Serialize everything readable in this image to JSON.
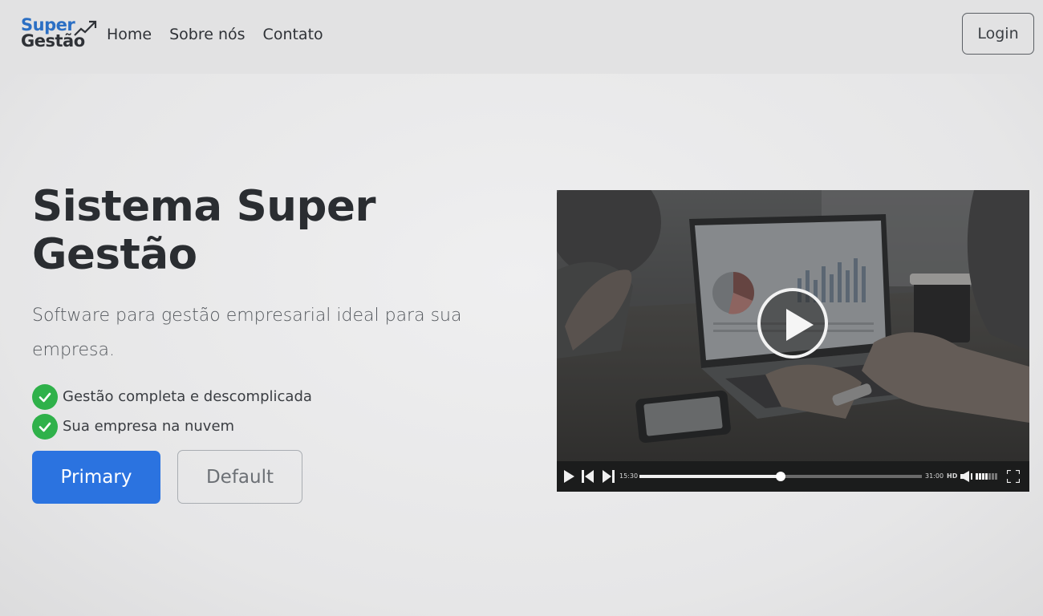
{
  "brand": {
    "line1": "Super",
    "line2": "Gestão",
    "color": "#2b6fc4"
  },
  "nav": {
    "links": [
      "Home",
      "Sobre nós",
      "Contato"
    ],
    "login_label": "Login"
  },
  "hero": {
    "title": "Sistema Super Gestão",
    "subtitle": "Software para gestão empresarial ideal para sua empresa.",
    "features": [
      "Gestão completa e descomplicada",
      "Sua empresa na nuvem"
    ],
    "primary_label": "Primary",
    "default_label": "Default"
  },
  "video": {
    "current_time": "15:30",
    "duration": "31:00",
    "quality": "HD",
    "progress": 0.5,
    "volume": 0.6
  },
  "colors": {
    "primary": "#2b73e0",
    "check": "#2fb14a"
  }
}
